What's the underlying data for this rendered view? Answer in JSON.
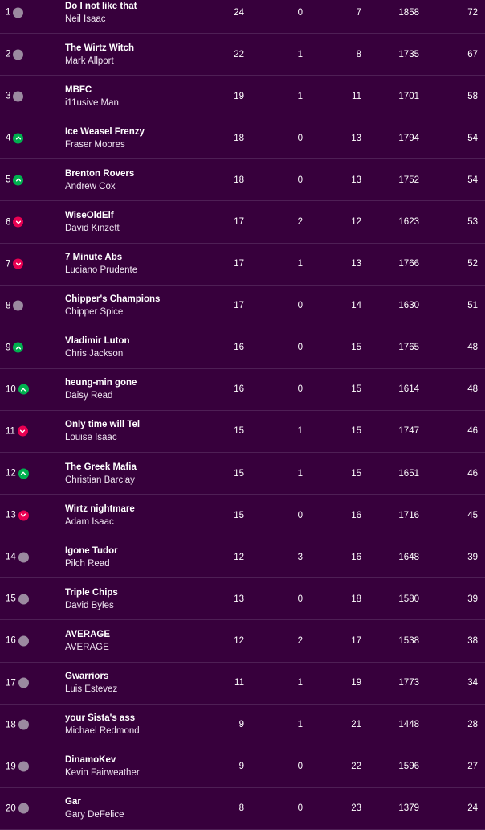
{
  "colors": {
    "background": "#37003c",
    "divider": "#4e1f55",
    "movement_same": "#9b8aa0",
    "movement_up": "#00b04f",
    "movement_down": "#e90052"
  },
  "standings": [
    {
      "rank": "1",
      "movement": "same",
      "team": "Do I not like that",
      "manager": "Neil Isaac",
      "w": "24",
      "d": "0",
      "l": "7",
      "pf": "1858",
      "pts": "72"
    },
    {
      "rank": "2",
      "movement": "same",
      "team": "The Wirtz Witch",
      "manager": "Mark Allport",
      "w": "22",
      "d": "1",
      "l": "8",
      "pf": "1735",
      "pts": "67"
    },
    {
      "rank": "3",
      "movement": "same",
      "team": "MBFC",
      "manager": "i11usive Man",
      "w": "19",
      "d": "1",
      "l": "11",
      "pf": "1701",
      "pts": "58"
    },
    {
      "rank": "4",
      "movement": "up",
      "team": "Ice Weasel Frenzy",
      "manager": "Fraser Moores",
      "w": "18",
      "d": "0",
      "l": "13",
      "pf": "1794",
      "pts": "54"
    },
    {
      "rank": "5",
      "movement": "up",
      "team": "Brenton Rovers",
      "manager": "Andrew Cox",
      "w": "18",
      "d": "0",
      "l": "13",
      "pf": "1752",
      "pts": "54"
    },
    {
      "rank": "6",
      "movement": "down",
      "team": "WiseOldElf",
      "manager": "David Kinzett",
      "w": "17",
      "d": "2",
      "l": "12",
      "pf": "1623",
      "pts": "53"
    },
    {
      "rank": "7",
      "movement": "down",
      "team": "7 Minute Abs",
      "manager": "Luciano Prudente",
      "w": "17",
      "d": "1",
      "l": "13",
      "pf": "1766",
      "pts": "52"
    },
    {
      "rank": "8",
      "movement": "same",
      "team": "Chipper's Champions",
      "manager": "Chipper Spice",
      "w": "17",
      "d": "0",
      "l": "14",
      "pf": "1630",
      "pts": "51"
    },
    {
      "rank": "9",
      "movement": "up",
      "team": "Vladimir Luton",
      "manager": "Chris Jackson",
      "w": "16",
      "d": "0",
      "l": "15",
      "pf": "1765",
      "pts": "48"
    },
    {
      "rank": "10",
      "movement": "up",
      "team": "heung-min gone",
      "manager": "Daisy Read",
      "w": "16",
      "d": "0",
      "l": "15",
      "pf": "1614",
      "pts": "48"
    },
    {
      "rank": "11",
      "movement": "down",
      "team": "Only time will Tel",
      "manager": "Louise Isaac",
      "w": "15",
      "d": "1",
      "l": "15",
      "pf": "1747",
      "pts": "46"
    },
    {
      "rank": "12",
      "movement": "up",
      "team": "The Greek Mafia",
      "manager": "Christian Barclay",
      "w": "15",
      "d": "1",
      "l": "15",
      "pf": "1651",
      "pts": "46"
    },
    {
      "rank": "13",
      "movement": "down",
      "team": "Wirtz nightmare",
      "manager": "Adam Isaac",
      "w": "15",
      "d": "0",
      "l": "16",
      "pf": "1716",
      "pts": "45"
    },
    {
      "rank": "14",
      "movement": "same",
      "team": "Igone Tudor",
      "manager": "Pilch Read",
      "w": "12",
      "d": "3",
      "l": "16",
      "pf": "1648",
      "pts": "39"
    },
    {
      "rank": "15",
      "movement": "same",
      "team": "Triple Chips",
      "manager": "David Byles",
      "w": "13",
      "d": "0",
      "l": "18",
      "pf": "1580",
      "pts": "39"
    },
    {
      "rank": "16",
      "movement": "same",
      "team": "AVERAGE",
      "manager": "AVERAGE",
      "w": "12",
      "d": "2",
      "l": "17",
      "pf": "1538",
      "pts": "38"
    },
    {
      "rank": "17",
      "movement": "same",
      "team": "Gwarriors",
      "manager": "Luis Estevez",
      "w": "11",
      "d": "1",
      "l": "19",
      "pf": "1773",
      "pts": "34"
    },
    {
      "rank": "18",
      "movement": "same",
      "team": "your Sista's ass",
      "manager": "Michael Redmond",
      "w": "9",
      "d": "1",
      "l": "21",
      "pf": "1448",
      "pts": "28"
    },
    {
      "rank": "19",
      "movement": "same",
      "team": "DinamoKev",
      "manager": "Kevin Fairweather",
      "w": "9",
      "d": "0",
      "l": "22",
      "pf": "1596",
      "pts": "27"
    },
    {
      "rank": "20",
      "movement": "same",
      "team": "Gar",
      "manager": "Gary DeFelice",
      "w": "8",
      "d": "0",
      "l": "23",
      "pf": "1379",
      "pts": "24"
    }
  ]
}
